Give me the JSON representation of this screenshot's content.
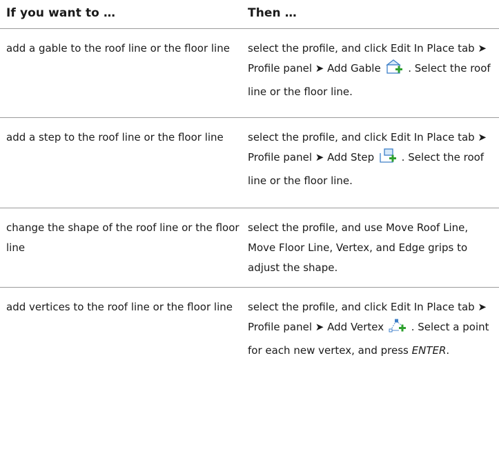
{
  "header": {
    "col1": "If you want to …",
    "col2": "Then …"
  },
  "rows": [
    {
      "condition": "add a gable to the roof line or the floor line",
      "before_icon": "select the profile, and click Edit In Place tab ➤ Profile panel ➤ Add Gable",
      "icon": "add-gable-icon",
      "after_icon": ". Select the roof line or the floor line."
    },
    {
      "condition": "add a step to the roof line or the floor line",
      "before_icon": "select the profile, and click Edit In Place tab ➤ Profile panel ➤ Add Step",
      "icon": "add-step-icon",
      "after_icon": ". Select the roof line or the floor line."
    },
    {
      "condition": "change the shape of the roof line or the floor line",
      "action": "select the profile, and use Move Roof Line, Move Floor Line, Vertex, and Edge grips to adjust the shape."
    },
    {
      "condition": "add vertices to the roof line or the floor line",
      "before_icon": "select the profile, and click Edit In Place tab ➤ Profile panel ➤ Add Vertex",
      "icon": "add-vertex-icon",
      "after_icon": ". Select a point for each new vertex, and press ",
      "key": "ENTER",
      "end": "."
    }
  ],
  "colors": {
    "rule": "#9a9a9a",
    "icon_blue": "#3d7fc8",
    "icon_green": "#2ea02e"
  }
}
